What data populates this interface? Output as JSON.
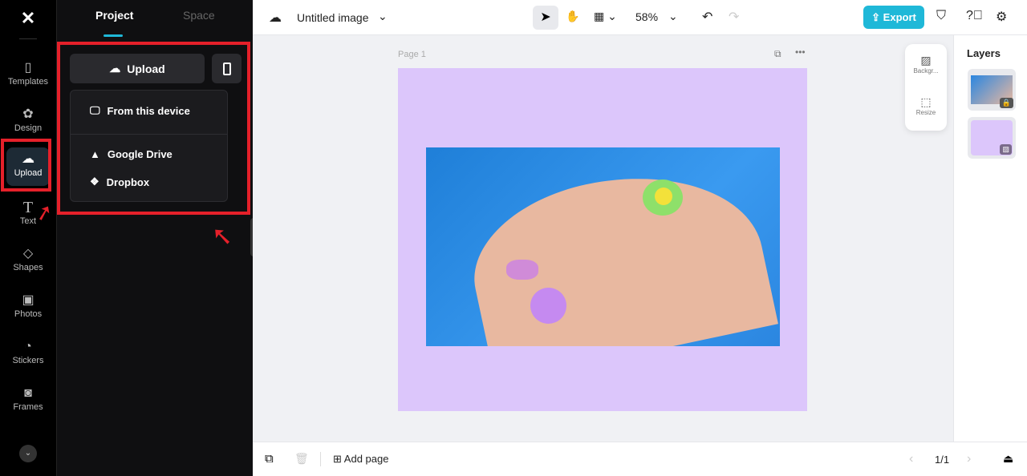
{
  "rail": {
    "items": [
      {
        "label": "Templates",
        "icon": "templates-icon"
      },
      {
        "label": "Design",
        "icon": "design-icon"
      },
      {
        "label": "Upload",
        "icon": "upload-cloud-icon"
      },
      {
        "label": "Text",
        "icon": "text-icon"
      },
      {
        "label": "Shapes",
        "icon": "shapes-icon"
      },
      {
        "label": "Photos",
        "icon": "photos-icon"
      },
      {
        "label": "Stickers",
        "icon": "stickers-icon"
      },
      {
        "label": "Frames",
        "icon": "frames-icon"
      }
    ]
  },
  "panel": {
    "tabs": [
      "Project",
      "Space"
    ],
    "upload_label": "Upload",
    "menu": [
      "From this device",
      "Google Drive",
      "Dropbox"
    ]
  },
  "topbar": {
    "title": "Untitled image",
    "zoom": "58%",
    "export": "Export"
  },
  "canvas": {
    "page_label": "Page 1"
  },
  "floating": {
    "background": "Backgr...",
    "resize": "Resize"
  },
  "layers": {
    "title": "Layers"
  },
  "bottombar": {
    "add_page": "Add page",
    "pages": "1/1"
  },
  "colors": {
    "accent": "#1fb8d8",
    "highlight": "#e5202a",
    "page_bg": "#dcc6fb"
  }
}
